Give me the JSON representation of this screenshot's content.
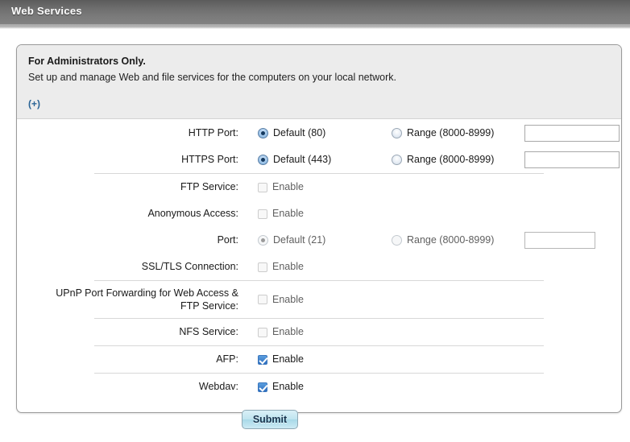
{
  "window": {
    "title": "Web Services"
  },
  "info": {
    "heading": "For Administrators Only.",
    "description": "Set up and manage Web and file services for the computers on your local network.",
    "expand_link": "(+)"
  },
  "form": {
    "enable_label": "Enable",
    "rows": [
      {
        "label": "HTTP Port:",
        "option_a": "Default (80)",
        "option_b": "Range (8000-8999)",
        "input_value": ""
      },
      {
        "label": "HTTPS Port:",
        "option_a": "Default (443)",
        "option_b": "Range (8000-8999)",
        "input_value": ""
      },
      {
        "label": "FTP Service:",
        "option_a": "Enable"
      },
      {
        "label": "Anonymous Access:",
        "option_a": "Enable"
      },
      {
        "label": "Port:",
        "option_a": "Default (21)",
        "option_b": "Range (8000-8999)",
        "input_value": ""
      },
      {
        "label": "SSL/TLS Connection:",
        "option_a": "Enable"
      },
      {
        "label": "UPnP Port Forwarding for Web Access &\nFTP Service:",
        "option_a": "Enable"
      },
      {
        "label": "NFS Service:",
        "option_a": "Enable"
      },
      {
        "label": "AFP:",
        "option_a": "Enable"
      },
      {
        "label": "Webdav:",
        "option_a": "Enable"
      }
    ],
    "submit_label": "Submit"
  },
  "colors": {
    "titlebar_dark": "#5b5b5b",
    "titlebar_light": "#818181",
    "accent_blue": "#2a6496",
    "checkbox_checked": "#2f6fbf",
    "panel_bg": "#ffffff",
    "info_bg": "#ececec"
  }
}
